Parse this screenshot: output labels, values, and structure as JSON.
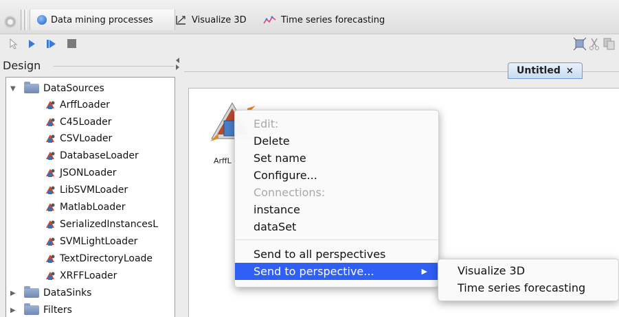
{
  "perspectives": {
    "items": [
      {
        "label": "Data mining processes",
        "icon": "blue-circle-icon",
        "active": true
      },
      {
        "label": "Visualize 3D",
        "icon": "visualize-3d-icon",
        "active": false
      },
      {
        "label": "Time series forecasting",
        "icon": "time-series-icon",
        "active": false
      }
    ]
  },
  "design": {
    "label": "Design",
    "tree": [
      {
        "label": "DataSources",
        "type": "folder",
        "expanded": true
      },
      {
        "label": "ArffLoader",
        "type": "loader"
      },
      {
        "label": "C45Loader",
        "type": "loader"
      },
      {
        "label": "CSVLoader",
        "type": "loader"
      },
      {
        "label": "DatabaseLoader",
        "type": "loader"
      },
      {
        "label": "JSONLoader",
        "type": "loader"
      },
      {
        "label": "LibSVMLoader",
        "type": "loader"
      },
      {
        "label": "MatlabLoader",
        "type": "loader"
      },
      {
        "label": "SerializedInstancesL",
        "type": "loader"
      },
      {
        "label": "SVMLightLoader",
        "type": "loader"
      },
      {
        "label": "TextDirectoryLoade",
        "type": "loader"
      },
      {
        "label": "XRFFLoader",
        "type": "loader"
      },
      {
        "label": "DataSinks",
        "type": "folder",
        "expanded": false
      },
      {
        "label": "Filters",
        "type": "folder",
        "expanded": false
      }
    ]
  },
  "canvas": {
    "tab_label": "Untitled",
    "tab_close": "×",
    "node_label": "ArffL"
  },
  "context_menu": {
    "items": [
      {
        "label": "Edit:",
        "disabled": true
      },
      {
        "label": "Delete"
      },
      {
        "label": "Set name"
      },
      {
        "label": "Configure..."
      },
      {
        "label": "Connections:",
        "disabled": true
      },
      {
        "label": "instance"
      },
      {
        "label": "dataSet"
      },
      {
        "label": "Send to all perspectives"
      },
      {
        "label": "Send to perspective...",
        "selected": true,
        "arrow": "▶"
      }
    ]
  },
  "submenu": {
    "items": [
      "Visualize 3D",
      "Time series forecasting"
    ]
  },
  "colors": {
    "selection": "#2f5ff5",
    "tab_border": "#6e9ad6"
  }
}
